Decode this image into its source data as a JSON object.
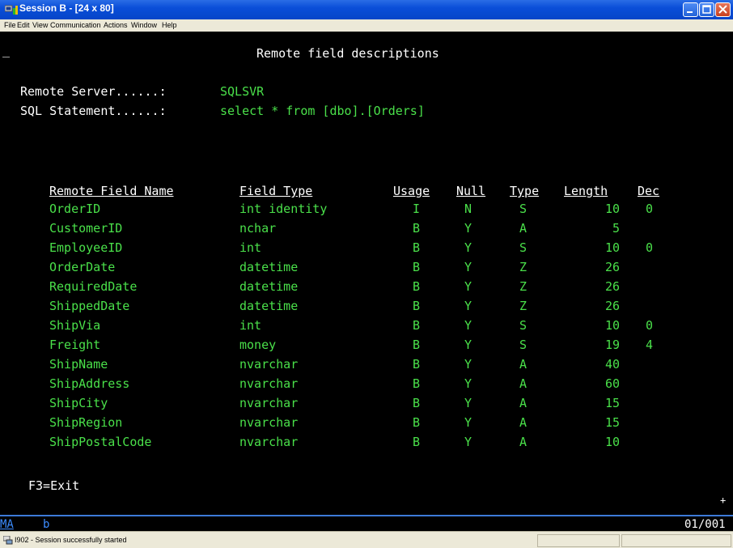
{
  "window": {
    "title": "Session B - [24 x 80]"
  },
  "menu": [
    "File",
    "Edit",
    "View",
    "Communication",
    "Actions",
    "Window",
    "Help"
  ],
  "screen": {
    "heading": "Remote field descriptions",
    "server_label": "Remote Server......:",
    "server_value": "SQLSVR",
    "sql_label": "SQL Statement......:",
    "sql_value": "select * from [dbo].[Orders]",
    "columns": [
      "Remote Field Name",
      "Field Type",
      "Usage",
      "Null",
      "Type",
      "Length",
      "Dec"
    ],
    "rows": [
      [
        "OrderID",
        "int identity",
        "I",
        "N",
        "S",
        "10",
        "0"
      ],
      [
        "CustomerID",
        "nchar",
        "B",
        "Y",
        "A",
        "5",
        ""
      ],
      [
        "EmployeeID",
        "int",
        "B",
        "Y",
        "S",
        "10",
        "0"
      ],
      [
        "OrderDate",
        "datetime",
        "B",
        "Y",
        "Z",
        "26",
        ""
      ],
      [
        "RequiredDate",
        "datetime",
        "B",
        "Y",
        "Z",
        "26",
        ""
      ],
      [
        "ShippedDate",
        "datetime",
        "B",
        "Y",
        "Z",
        "26",
        ""
      ],
      [
        "ShipVia",
        "int",
        "B",
        "Y",
        "S",
        "10",
        "0"
      ],
      [
        "Freight",
        "money",
        "B",
        "Y",
        "S",
        "19",
        "4"
      ],
      [
        "ShipName",
        "nvarchar",
        "B",
        "Y",
        "A",
        "40",
        ""
      ],
      [
        "ShipAddress",
        "nvarchar",
        "B",
        "Y",
        "A",
        "60",
        ""
      ],
      [
        "ShipCity",
        "nvarchar",
        "B",
        "Y",
        "A",
        "15",
        ""
      ],
      [
        "ShipRegion",
        "nvarchar",
        "B",
        "Y",
        "A",
        "15",
        ""
      ],
      [
        "ShipPostalCode",
        "nvarchar",
        "B",
        "Y",
        "A",
        "10",
        ""
      ]
    ],
    "function_key": "F3=Exit",
    "more_indicator": "+"
  },
  "oia": {
    "indicator": "MA",
    "keyboard_char": "b",
    "cursor_position": "01/001"
  },
  "status": {
    "message": "I902 - Session successfully started"
  }
}
